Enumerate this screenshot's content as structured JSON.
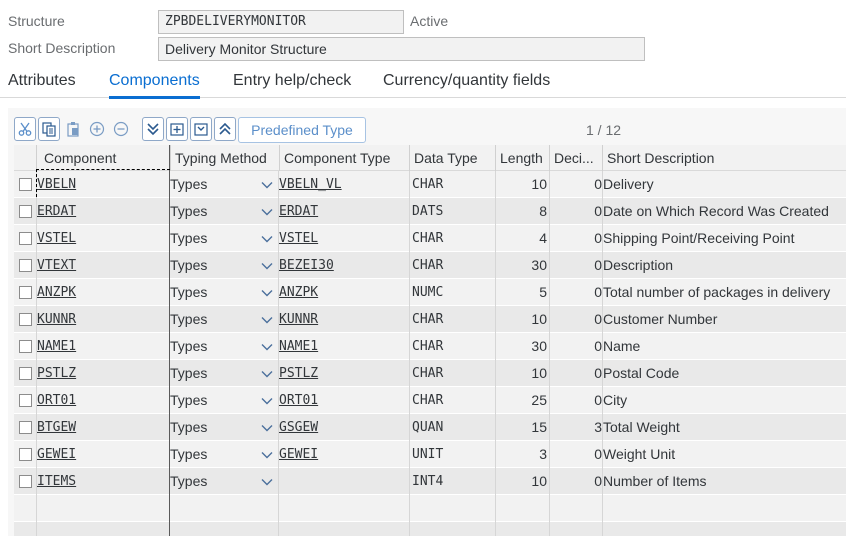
{
  "header": {
    "structure_label": "Structure",
    "structure_value": "ZPBDELIVERYMONITOR",
    "status": "Active",
    "short_desc_label": "Short Description",
    "short_desc_value": "Delivery Monitor Structure"
  },
  "tabs": [
    {
      "label": "Attributes",
      "active": false
    },
    {
      "label": "Components",
      "active": true
    },
    {
      "label": "Entry help/check",
      "active": false
    },
    {
      "label": "Currency/quantity fields",
      "active": false
    }
  ],
  "toolbar": {
    "icons": [
      "cut-icon",
      "copy-icon",
      "paste-icon",
      "insert-row-icon",
      "delete-row-icon",
      "expand-down-icon",
      "insert-field-icon",
      "collapse-field-icon",
      "expand-up-icon"
    ],
    "predefined_type_label": "Predefined Type",
    "pager": "1 / 12"
  },
  "columns": [
    "Component",
    "Typing Method",
    "Component Type",
    "Data Type",
    "Length",
    "Deci...",
    "Short Description"
  ],
  "rows": [
    {
      "component": "VBELN",
      "typing": "Types",
      "comp_type": "VBELN_VL",
      "data_type": "CHAR",
      "length": "10",
      "decimals": "0",
      "desc": "Delivery"
    },
    {
      "component": "ERDAT",
      "typing": "Types",
      "comp_type": "ERDAT",
      "data_type": "DATS",
      "length": "8",
      "decimals": "0",
      "desc": "Date on Which Record Was Created"
    },
    {
      "component": "VSTEL",
      "typing": "Types",
      "comp_type": "VSTEL",
      "data_type": "CHAR",
      "length": "4",
      "decimals": "0",
      "desc": "Shipping Point/Receiving Point"
    },
    {
      "component": "VTEXT",
      "typing": "Types",
      "comp_type": "BEZEI30",
      "data_type": "CHAR",
      "length": "30",
      "decimals": "0",
      "desc": "Description"
    },
    {
      "component": "ANZPK",
      "typing": "Types",
      "comp_type": "ANZPK",
      "data_type": "NUMC",
      "length": "5",
      "decimals": "0",
      "desc": "Total number of packages in delivery"
    },
    {
      "component": "KUNNR",
      "typing": "Types",
      "comp_type": "KUNNR",
      "data_type": "CHAR",
      "length": "10",
      "decimals": "0",
      "desc": "Customer Number"
    },
    {
      "component": "NAME1",
      "typing": "Types",
      "comp_type": "NAME1",
      "data_type": "CHAR",
      "length": "30",
      "decimals": "0",
      "desc": "Name"
    },
    {
      "component": "PSTLZ",
      "typing": "Types",
      "comp_type": "PSTLZ",
      "data_type": "CHAR",
      "length": "10",
      "decimals": "0",
      "desc": "Postal Code"
    },
    {
      "component": "ORT01",
      "typing": "Types",
      "comp_type": "ORT01",
      "data_type": "CHAR",
      "length": "25",
      "decimals": "0",
      "desc": "City"
    },
    {
      "component": "BTGEW",
      "typing": "Types",
      "comp_type": "GSGEW",
      "data_type": "QUAN",
      "length": "15",
      "decimals": "3",
      "desc": "Total Weight"
    },
    {
      "component": "GEWEI",
      "typing": "Types",
      "comp_type": "GEWEI",
      "data_type": "UNIT",
      "length": "3",
      "decimals": "0",
      "desc": "Weight Unit"
    },
    {
      "component": "ITEMS",
      "typing": "Types",
      "comp_type": "",
      "data_type": "INT4",
      "length": "10",
      "decimals": "0",
      "desc": "Number of Items"
    }
  ],
  "colors": {
    "accent": "#0a6ed1",
    "link_button": "#5b8fca"
  }
}
